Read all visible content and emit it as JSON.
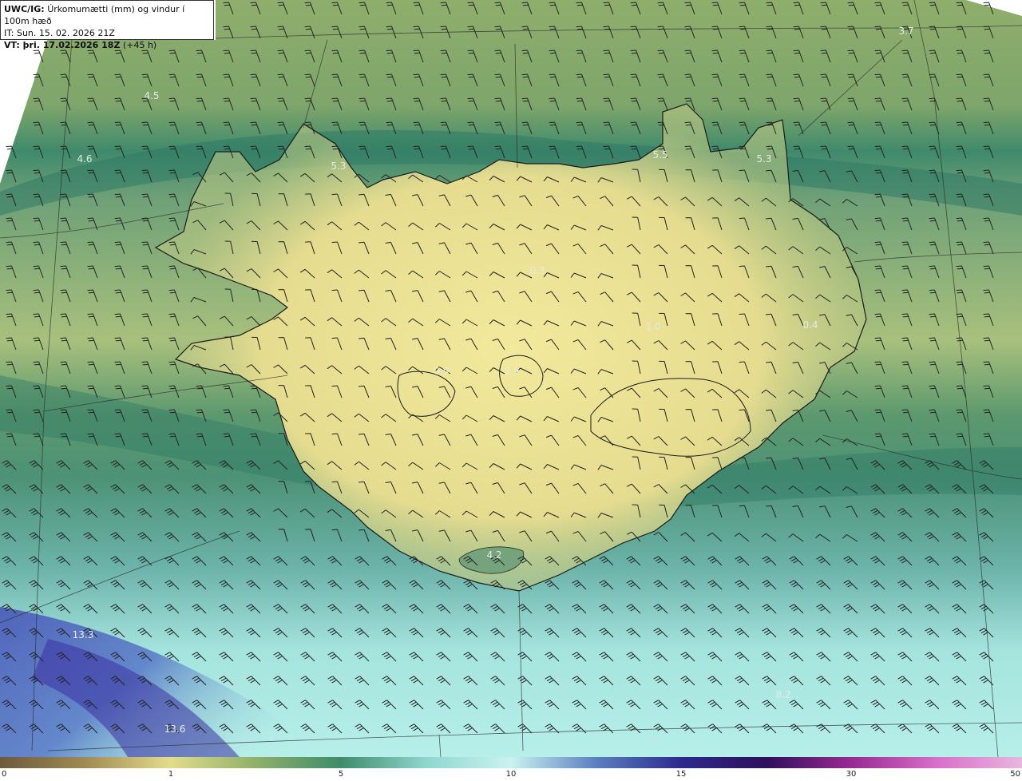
{
  "header": {
    "line1_bold": "UWC/IG:",
    "line1_rest": "Úrkomumætti (mm) og vindur í 100m hæð",
    "line2": "IT: Sun. 15. 02. 2026 21Z",
    "line3_bold": "VT: þri. 17.02.2026 18Z",
    "line3_rest": "(+45 h)"
  },
  "map_labels": [
    {
      "text": "4.5"
    },
    {
      "text": "4.6"
    },
    {
      "text": "5.3"
    },
    {
      "text": "5.5"
    },
    {
      "text": "5.3"
    },
    {
      "text": "3.7"
    },
    {
      "text": "0.3"
    },
    {
      "text": "1.0"
    },
    {
      "text": "0.9"
    },
    {
      "text": "0.9"
    },
    {
      "text": "0.4"
    },
    {
      "text": "4.2"
    },
    {
      "text": "13.3"
    },
    {
      "text": "13.6"
    },
    {
      "text": "8.2"
    }
  ],
  "colorbar": {
    "ticks": [
      "0",
      "1",
      "5",
      "10",
      "15",
      "30",
      "50"
    ],
    "colors": [
      "#6d5a3e",
      "#a08a52",
      "#e3dc8c",
      "#8fb06a",
      "#3f8c6a",
      "#8fd6cf",
      "#c9f3ef",
      "#5a7fc0",
      "#2c2a8e",
      "#2f0f5a",
      "#9a2a93",
      "#d86fc9",
      "#e9b6df"
    ]
  },
  "palette": {
    "land_bright": "#f0e79a",
    "land_mid": "#bccb84",
    "sea_green": "#6a9f75",
    "dark_band": "#2f7a66",
    "cyan": "#9ae3dc",
    "blue": "#4a58b8",
    "purple": "#4a2ea0"
  }
}
